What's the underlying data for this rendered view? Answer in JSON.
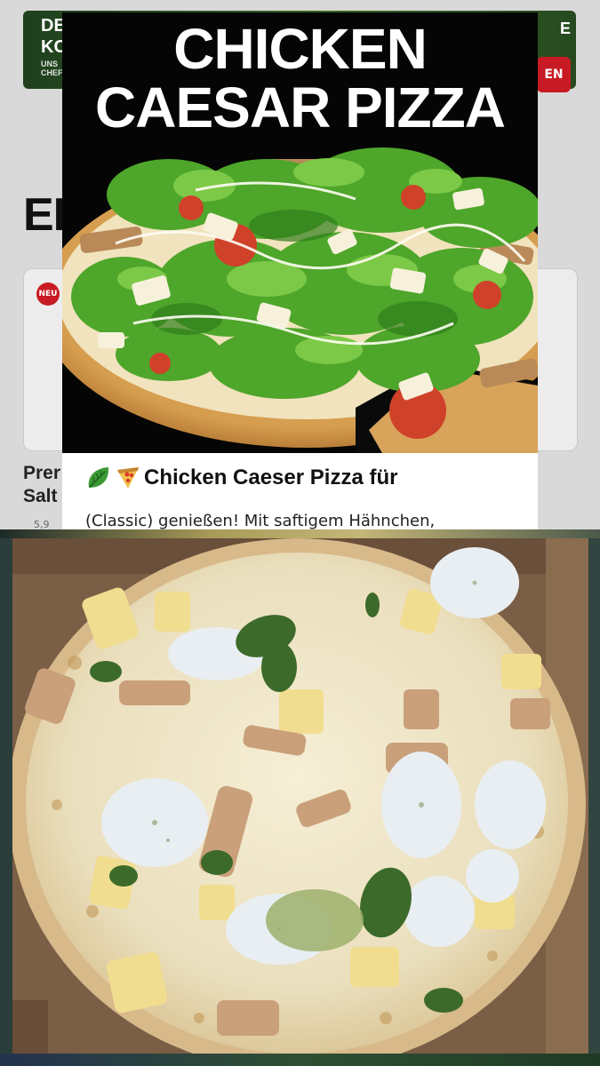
{
  "background_app": {
    "banner": {
      "line1": "DE",
      "line2": "KC",
      "line3": "UNS",
      "line4": "CHEF",
      "right_text": "E",
      "cta": "EN"
    },
    "section_heading": "EI",
    "badge": "NEU",
    "product_name": "Prer Salt",
    "product_price": "5,9"
  },
  "promo": {
    "title_line1": "CHICKEN",
    "title_line2": "CAESAR PIZZA",
    "headline": "Chicken Caeser Pizza für",
    "body": "(Classic) genießen! Mit saftigem Hähnchen,",
    "emoji_icons": [
      "leafy-green-icon",
      "pizza-slice-icon"
    ]
  },
  "colors": {
    "hero_background": "#050505",
    "badge_red": "#c81a24",
    "lettuce_green": "#4ea62a",
    "tomato_red": "#d0412a",
    "divider_gold": "#b9a96a"
  }
}
